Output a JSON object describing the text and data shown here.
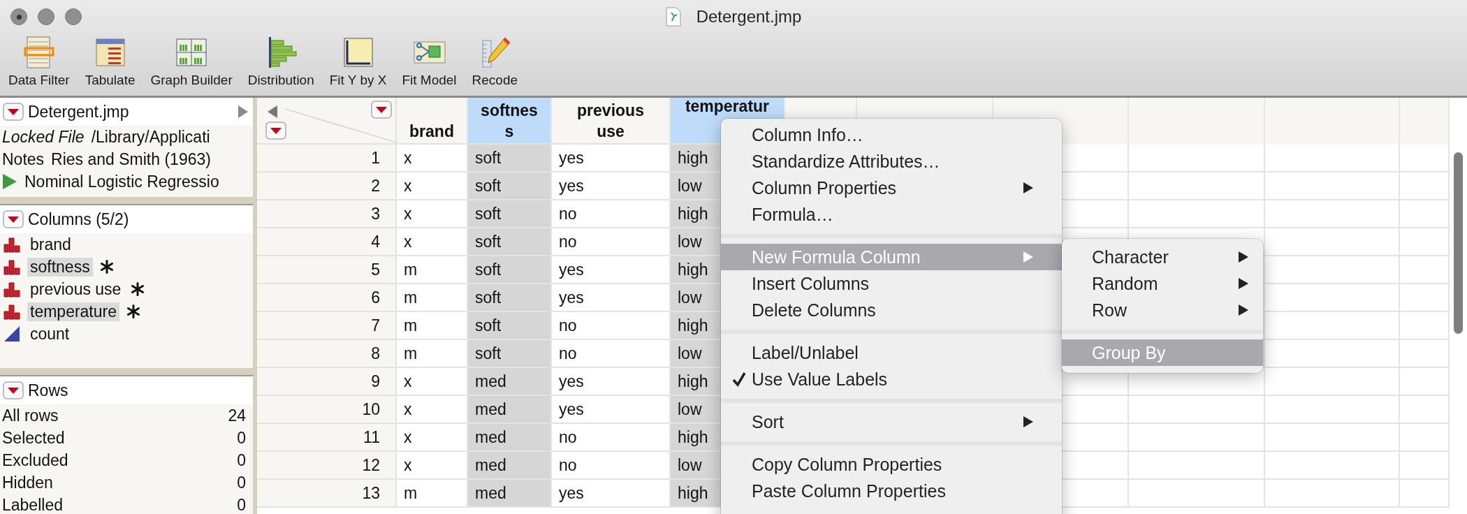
{
  "window": {
    "title": "Detergent.jmp"
  },
  "toolbar": [
    {
      "label": "Data Filter"
    },
    {
      "label": "Tabulate"
    },
    {
      "label": "Graph Builder"
    },
    {
      "label": "Distribution"
    },
    {
      "label": "Fit Y by X"
    },
    {
      "label": "Fit Model"
    },
    {
      "label": "Recode"
    }
  ],
  "table_panel": {
    "title": "Detergent.jmp",
    "properties": [
      {
        "kind": "locked",
        "name": "Locked File",
        "value": "/Library/Applicati"
      },
      {
        "kind": "note",
        "name": "Notes",
        "value": "Ries and Smith (1963)"
      }
    ],
    "scripts": [
      {
        "label": "Nominal Logistic Regressio"
      }
    ]
  },
  "columns_panel": {
    "title": "Columns (5/2)",
    "items": [
      {
        "name": "brand",
        "kind": "nominal",
        "selected": false,
        "asterisk": false
      },
      {
        "name": "softness",
        "kind": "nominal",
        "selected": true,
        "asterisk": true
      },
      {
        "name": "previous use",
        "kind": "nominal",
        "selected": false,
        "asterisk": true
      },
      {
        "name": "temperature",
        "kind": "nominal",
        "selected": true,
        "asterisk": true
      },
      {
        "name": "count",
        "kind": "continuous",
        "selected": false,
        "asterisk": false
      }
    ]
  },
  "rows_panel": {
    "title": "Rows",
    "items": [
      {
        "label": "All rows",
        "value": "24"
      },
      {
        "label": "Selected",
        "value": "0"
      },
      {
        "label": "Excluded",
        "value": "0"
      },
      {
        "label": "Hidden",
        "value": "0"
      },
      {
        "label": "Labelled",
        "value": "0"
      }
    ]
  },
  "table": {
    "columns": [
      {
        "lines": [
          "brand"
        ],
        "selected": false
      },
      {
        "lines": [
          "softnes",
          "s"
        ],
        "selected": true
      },
      {
        "lines": [
          "previous",
          "use"
        ],
        "selected": false
      },
      {
        "lines": [
          "temperatur"
        ],
        "selected": true,
        "continued": true
      }
    ],
    "rows": [
      {
        "number": "1",
        "cells": [
          "x",
          "soft",
          "yes",
          "high"
        ]
      },
      {
        "number": "2",
        "cells": [
          "x",
          "soft",
          "yes",
          "low"
        ]
      },
      {
        "number": "3",
        "cells": [
          "x",
          "soft",
          "no",
          "high"
        ]
      },
      {
        "number": "4",
        "cells": [
          "x",
          "soft",
          "no",
          "low"
        ]
      },
      {
        "number": "5",
        "cells": [
          "m",
          "soft",
          "yes",
          "high"
        ]
      },
      {
        "number": "6",
        "cells": [
          "m",
          "soft",
          "yes",
          "low"
        ]
      },
      {
        "number": "7",
        "cells": [
          "m",
          "soft",
          "no",
          "high"
        ]
      },
      {
        "number": "8",
        "cells": [
          "m",
          "soft",
          "no",
          "low"
        ]
      },
      {
        "number": "9",
        "cells": [
          "x",
          "med",
          "yes",
          "high"
        ]
      },
      {
        "number": "10",
        "cells": [
          "x",
          "med",
          "yes",
          "low"
        ]
      },
      {
        "number": "11",
        "cells": [
          "x",
          "med",
          "no",
          "high"
        ]
      },
      {
        "number": "12",
        "cells": [
          "x",
          "med",
          "no",
          "low"
        ]
      },
      {
        "number": "13",
        "cells": [
          "m",
          "med",
          "yes",
          "high"
        ]
      }
    ]
  },
  "context_menu": {
    "items": [
      {
        "kind": "item",
        "label": "Column Info…",
        "submenu": false,
        "selected": false,
        "checked": false
      },
      {
        "kind": "item",
        "label": "Standardize Attributes…",
        "submenu": false,
        "selected": false,
        "checked": false
      },
      {
        "kind": "item",
        "label": "Column Properties",
        "submenu": true,
        "selected": false,
        "checked": false
      },
      {
        "kind": "item",
        "label": "Formula…",
        "submenu": false,
        "selected": false,
        "checked": false
      },
      {
        "kind": "separator"
      },
      {
        "kind": "item",
        "label": "New Formula Column",
        "submenu": true,
        "selected": true,
        "checked": false
      },
      {
        "kind": "item",
        "label": "Insert Columns",
        "submenu": false,
        "selected": false,
        "checked": false
      },
      {
        "kind": "item",
        "label": "Delete Columns",
        "submenu": false,
        "selected": false,
        "checked": false
      },
      {
        "kind": "separator"
      },
      {
        "kind": "item",
        "label": "Label/Unlabel",
        "submenu": false,
        "selected": false,
        "checked": false
      },
      {
        "kind": "item",
        "label": "Use Value Labels",
        "submenu": false,
        "selected": false,
        "checked": true
      },
      {
        "kind": "separator"
      },
      {
        "kind": "item",
        "label": "Sort",
        "submenu": true,
        "selected": false,
        "checked": false
      },
      {
        "kind": "separator"
      },
      {
        "kind": "item",
        "label": "Copy Column Properties",
        "submenu": false,
        "selected": false,
        "checked": false
      },
      {
        "kind": "item",
        "label": "Paste Column Properties",
        "submenu": false,
        "selected": false,
        "checked": false
      }
    ]
  },
  "submenu": {
    "items": [
      {
        "kind": "item",
        "label": "Character",
        "submenu": true,
        "selected": false
      },
      {
        "kind": "item",
        "label": "Random",
        "submenu": true,
        "selected": false
      },
      {
        "kind": "item",
        "label": "Row",
        "submenu": true,
        "selected": false
      },
      {
        "kind": "separator"
      },
      {
        "kind": "item",
        "label": "Group By",
        "submenu": false,
        "selected": true
      }
    ]
  }
}
